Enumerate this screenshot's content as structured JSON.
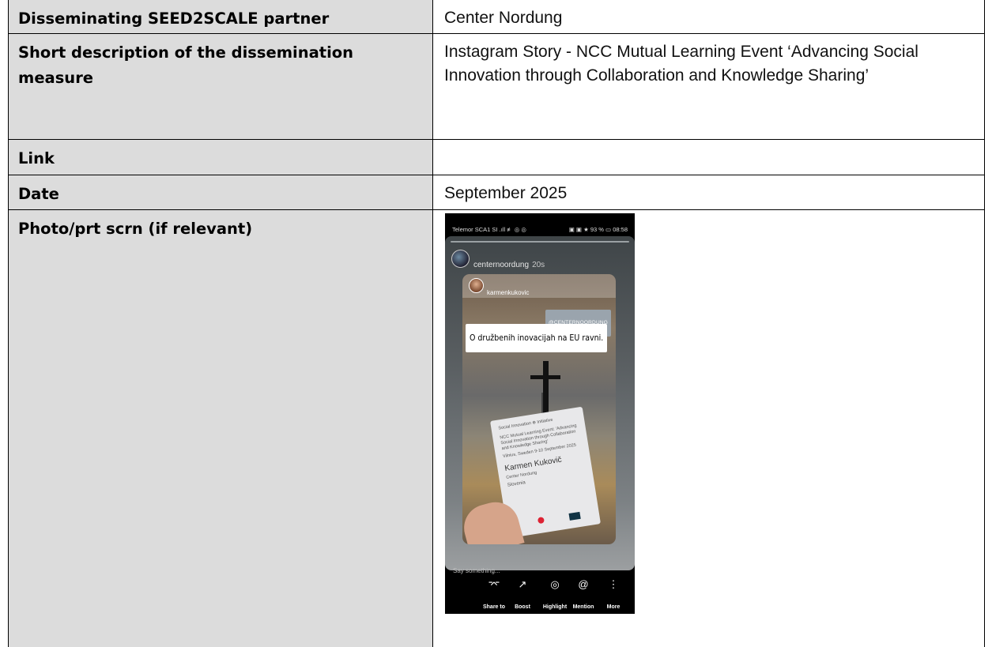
{
  "rows": [
    {
      "label": "Disseminating SEED2SCALE partner",
      "value": "Center Nordung"
    },
    {
      "label": "Short description of the dissemination measure",
      "value": "Instagram Story -  NCC Mutual Learning Event ‘Advancing Social Innovation through Collaboration and Knowledge Sharing’"
    },
    {
      "label": "Link",
      "value": ""
    },
    {
      "label": "Date",
      "value": "September 2025"
    },
    {
      "label": "Photo/prt scrn (if relevant)",
      "value": ""
    }
  ],
  "screenshot": {
    "status_left": "Telemor SCA1 SI  .ıll ≢ ◎ ◎",
    "status_right": "▣ ▣ ★ 93 % ▭ 08:58",
    "account": "centernoordung",
    "time": "20s",
    "poster": "karmenkukovic",
    "tag": "@CENTERNOORDUNG",
    "caption": "O družbenih inovacijah na EU ravni.",
    "badge": {
      "org": "Social Innovation ⊕ Initiative",
      "event": "NCC Mutual Learning Event: 'Advancing Social Innovation through Collaboration and Knowledge Sharing'",
      "place": "Vilnius, Sweden 9-10 September 2025",
      "name": "Karmen Kukovič",
      "org2": "Center Nordung",
      "country": "Slovenia"
    },
    "reply_placeholder": "Say something...",
    "actions": [
      {
        "icon": "⌤",
        "label": "Share to"
      },
      {
        "icon": "↗",
        "label": "Boost"
      },
      {
        "icon": "◎",
        "label": "Highlight"
      },
      {
        "icon": "@",
        "label": "Mention"
      },
      {
        "icon": "⋮",
        "label": "More"
      }
    ]
  }
}
